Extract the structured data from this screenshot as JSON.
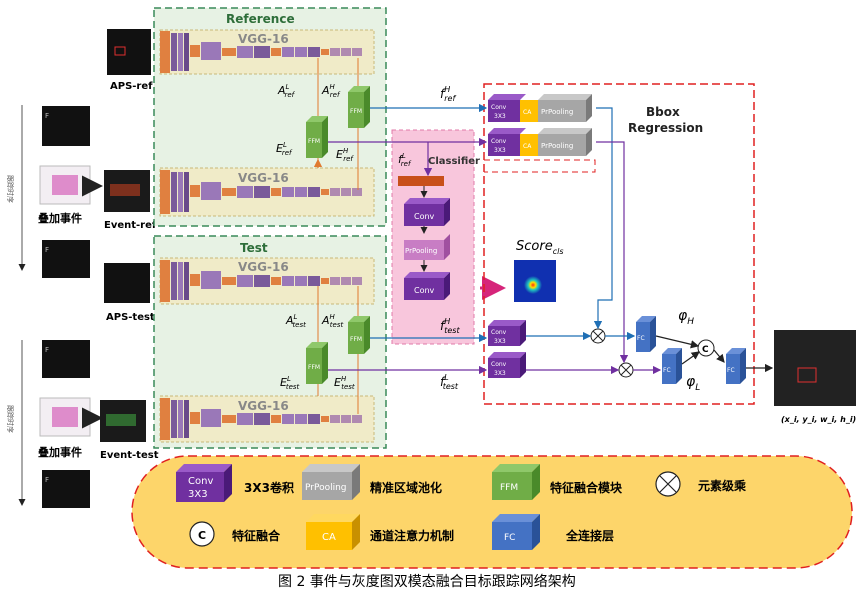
{
  "panels": {
    "reference_title": "Reference",
    "test_title": "Test",
    "classifier_title": "Classifier",
    "bbox_title_line1": "Bbox",
    "bbox_title_line2": "Regression"
  },
  "backbones": {
    "vgg_ref_top": "VGG-16",
    "vgg_ref_bottom": "VGG-16",
    "vgg_test_top": "VGG-16",
    "vgg_test_bottom": "VGG-16"
  },
  "inputs": {
    "aps_ref": "APS-ref",
    "event_ref": "Event-ref",
    "aps_test": "APS-test",
    "event_test": "Event-test",
    "stack_events_1": "叠加事件",
    "stack_events_2": "叠加事件",
    "frame_t": "F",
    "frame_t1": "F",
    "timeline_label": "跟踪时序"
  },
  "features": {
    "a_ref_l": "A",
    "a_ref_l_sub": "ref",
    "a_ref_l_sup": "L",
    "a_ref_h": "A",
    "a_ref_h_sub": "ref",
    "a_ref_h_sup": "H",
    "e_ref_l": "E",
    "e_ref_l_sub": "ref",
    "e_ref_l_sup": "L",
    "e_ref_h": "E",
    "e_ref_h_sub": "ref",
    "e_ref_h_sup": "H",
    "a_test_l": "A",
    "a_test_l_sub": "test",
    "a_test_l_sup": "L",
    "a_test_h": "A",
    "a_test_h_sub": "test",
    "a_test_h_sup": "H",
    "e_test_l": "E",
    "e_test_l_sub": "test",
    "e_test_l_sup": "L",
    "e_test_h": "E",
    "e_test_h_sub": "test",
    "e_test_h_sup": "H",
    "f_ref_h": "f",
    "f_ref_h_sub": "ref",
    "f_ref_h_sup": "H",
    "f_ref_l": "f",
    "f_ref_l_sub": "ref",
    "f_ref_l_sup": "L",
    "f_test_h": "f",
    "f_test_h_sub": "test",
    "f_test_h_sup": "H",
    "f_test_l": "f",
    "f_test_l_sub": "test",
    "f_test_l_sup": "L"
  },
  "blocks": {
    "ffm": "FFM",
    "conv": "Conv",
    "conv_3x3_a": "Conv",
    "conv_3x3_b": "3X3",
    "ca": "CA",
    "prpooling": "PrPooling",
    "fc": "FC",
    "concat": "C"
  },
  "outputs": {
    "score": "Score",
    "score_sub": "cls",
    "phi_h": "φ",
    "phi_h_sub": "H",
    "phi_l": "φ",
    "phi_l_sub": "L",
    "bbox_output": "(x_i, y_i, w_i, h_i)"
  },
  "legend": {
    "conv_a": "Conv",
    "conv_b": "3X3",
    "conv_desc": "3X3卷积",
    "prpool": "PrPooling",
    "prpool_desc": "精准区域池化",
    "ffm": "FFM",
    "ffm_desc": "特征融合模块",
    "mult_desc": "元素级乘",
    "concat": "C",
    "concat_desc": "特征融合",
    "ca": "CA",
    "ca_desc": "通道注意力机制",
    "fc": "FC",
    "fc_desc": "全连接层"
  },
  "caption": "图 2  事件与灰度图双模态融合目标跟踪网络架构",
  "colors": {
    "conv": "#7030A0",
    "ca": "#FFC000",
    "prpool": "#A6A6A6",
    "ffm": "#70AD47",
    "fc": "#4472C4",
    "vgg_panel": "#EAF1DD",
    "classifier_panel": "#F8C6DC",
    "legend_bg": "#FDD56A",
    "bbox_border": "#E02020",
    "panel_border": "#3A8A5A"
  }
}
